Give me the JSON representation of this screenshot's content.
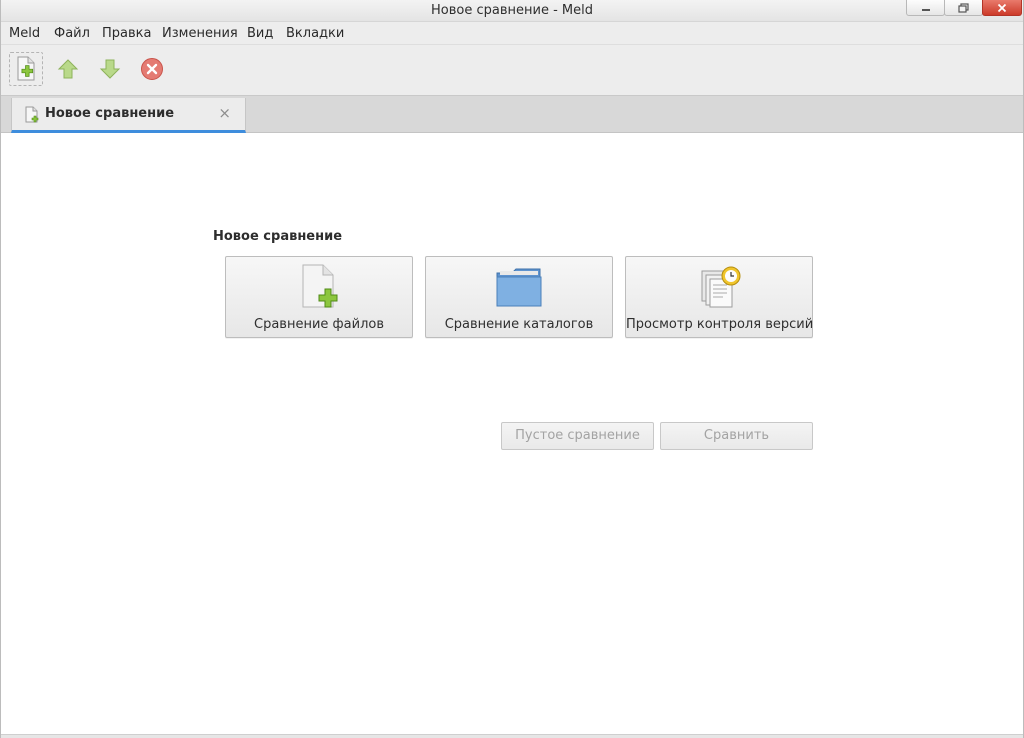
{
  "window": {
    "title": "Новое сравнение - Meld"
  },
  "menu": {
    "items": [
      {
        "label": "Meld"
      },
      {
        "label": "Файл"
      },
      {
        "label": "Правка"
      },
      {
        "label": "Изменения"
      },
      {
        "label": "Вид"
      },
      {
        "label": "Вкладки"
      }
    ]
  },
  "toolbar": {
    "buttons": [
      {
        "icon": "new-document-icon"
      },
      {
        "icon": "arrow-up-icon"
      },
      {
        "icon": "arrow-down-icon"
      },
      {
        "icon": "stop-icon"
      }
    ]
  },
  "tabs": [
    {
      "label": "Новое сравнение",
      "close": "×",
      "active": true
    }
  ],
  "main": {
    "section_title": "Новое сравнение",
    "compare_buttons": [
      {
        "label": "Сравнение файлов",
        "icon": "file-add-icon"
      },
      {
        "label": "Сравнение каталогов",
        "icon": "folder-icon"
      },
      {
        "label": "Просмотр контроля версий",
        "icon": "version-control-icon"
      }
    ],
    "actions": {
      "blank_label": "Пустое сравнение",
      "compare_label": "Сравнить"
    }
  },
  "colors": {
    "accent": "#3e8ddd",
    "close_button": "#d4493a",
    "toolbar_green": "#9bc255",
    "toolbar_red": "#e0554a"
  }
}
